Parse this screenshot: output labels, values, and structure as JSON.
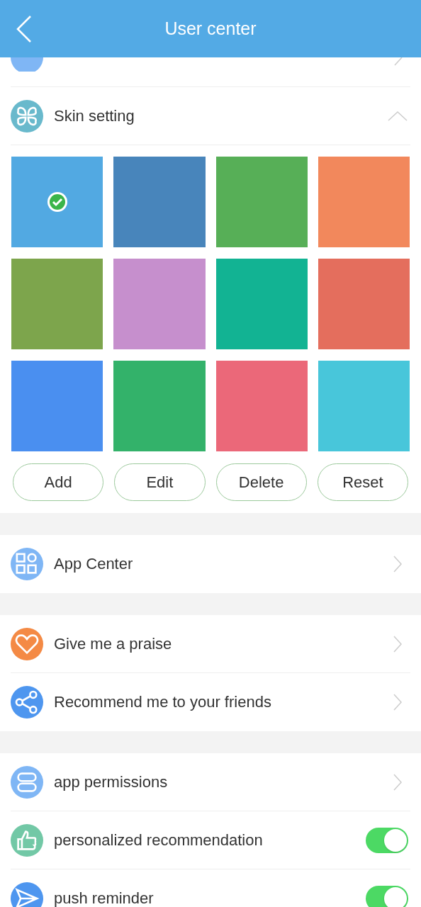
{
  "header": {
    "title": "User center"
  },
  "skin_row": {
    "label": "Skin setting",
    "expanded": true
  },
  "skins": [
    {
      "color": "#52a9e2",
      "selected": true
    },
    {
      "color": "#4885bb",
      "selected": false
    },
    {
      "color": "#57af57",
      "selected": false
    },
    {
      "color": "#f2885c",
      "selected": false
    },
    {
      "color": "#7da54c",
      "selected": false
    },
    {
      "color": "#c68fcd",
      "selected": false
    },
    {
      "color": "#12b393",
      "selected": false
    },
    {
      "color": "#e46e5d",
      "selected": false
    },
    {
      "color": "#4a8ff0",
      "selected": false
    },
    {
      "color": "#33b26a",
      "selected": false
    },
    {
      "color": "#eb6879",
      "selected": false
    },
    {
      "color": "#48c6da",
      "selected": false
    }
  ],
  "skin_buttons": [
    "Add",
    "Edit",
    "Delete",
    "Reset"
  ],
  "groups": [
    [
      {
        "label": "App Center",
        "kind": "chevron"
      }
    ],
    [
      {
        "label": "Give me a praise",
        "kind": "chevron"
      },
      {
        "label": "Recommend me to your friends",
        "kind": "chevron"
      }
    ],
    [
      {
        "label": "app permissions",
        "kind": "chevron"
      },
      {
        "label": "personalized recommendation",
        "kind": "toggle",
        "on": true
      },
      {
        "label": "push reminder",
        "kind": "toggle",
        "on": true
      }
    ]
  ]
}
